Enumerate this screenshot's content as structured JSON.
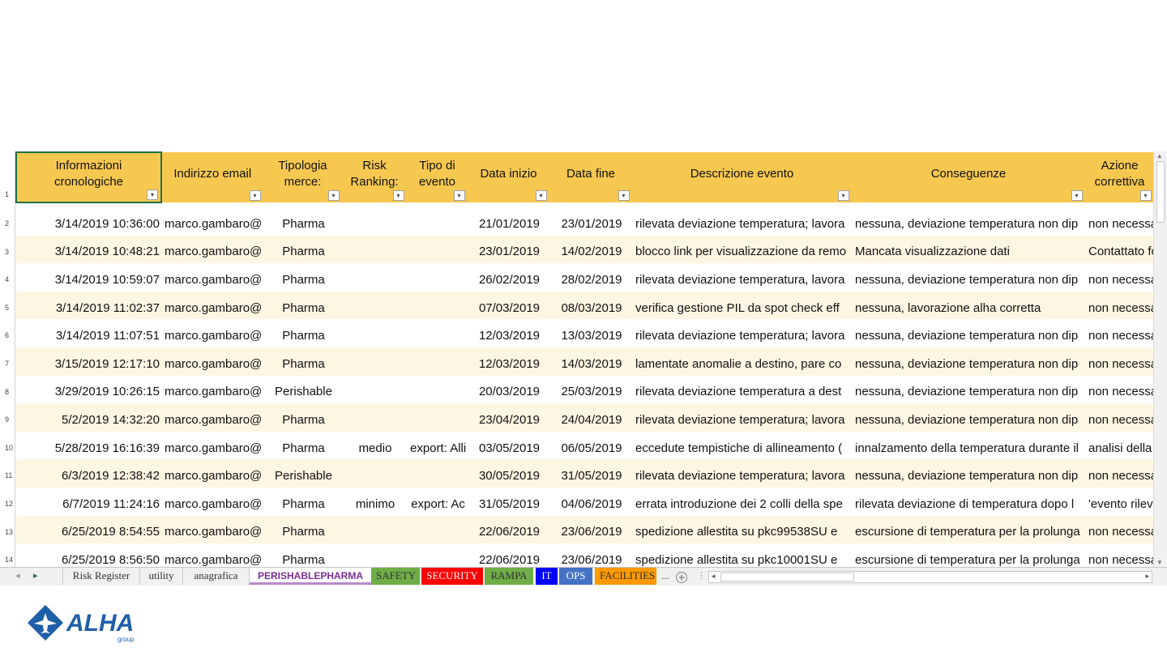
{
  "headers": [
    "Informazioni cronologiche",
    "Indirizzo email",
    "Tipologia merce:",
    "Risk Ranking:",
    "Tipo di evento",
    "Data inizio",
    "Data fine",
    "Descrizione evento",
    "Conseguenze",
    "Azione correttiva"
  ],
  "header_row_number": "1",
  "rows": [
    {
      "n": "2",
      "ts": "3/14/2019 10:36:00",
      "email": "marco.gambaro@",
      "merce": "Pharma",
      "risk": "",
      "tipo": "",
      "inizio": "21/01/2019",
      "fine": "23/01/2019",
      "desc": "rilevata deviazione temperatura; lavora",
      "cons": "nessuna, deviazione temperatura non dip",
      "azione": "non necessa"
    },
    {
      "n": "3",
      "ts": "3/14/2019 10:48:21",
      "email": "marco.gambaro@",
      "merce": "Pharma",
      "risk": "",
      "tipo": "",
      "inizio": "23/01/2019",
      "fine": "14/02/2019",
      "desc": "blocco link per visualizzazione da remo",
      "cons": "Mancata visualizzazione dati",
      "azione": "Contattato fo"
    },
    {
      "n": "4",
      "ts": "3/14/2019 10:59:07",
      "email": "marco.gambaro@",
      "merce": "Pharma",
      "risk": "",
      "tipo": "",
      "inizio": "26/02/2019",
      "fine": "28/02/2019",
      "desc": "rilevata deviazione temperatura, lavora",
      "cons": "nessuna, deviazione temperatura non dip",
      "azione": "non necessa"
    },
    {
      "n": "5",
      "ts": "3/14/2019 11:02:37",
      "email": "marco.gambaro@",
      "merce": "Pharma",
      "risk": "",
      "tipo": "",
      "inizio": "07/03/2019",
      "fine": "08/03/2019",
      "desc": "verifica gestione PIL da spot check eff",
      "cons": "nessuna, lavorazione alha corretta",
      "azione": "non necessa"
    },
    {
      "n": "6",
      "ts": "3/14/2019 11:07:51",
      "email": "marco.gambaro@",
      "merce": "Pharma",
      "risk": "",
      "tipo": "",
      "inizio": "12/03/2019",
      "fine": "13/03/2019",
      "desc": "rilevata deviazione temperatura; lavora",
      "cons": "nessuna, deviazione temperatura non dip",
      "azione": "non necessa"
    },
    {
      "n": "7",
      "ts": "3/15/2019 12:17:10",
      "email": "marco.gambaro@",
      "merce": "Pharma",
      "risk": "",
      "tipo": "",
      "inizio": "12/03/2019",
      "fine": "14/03/2019",
      "desc": "lamentate anomalie a destino, pare co",
      "cons": "nessuna, deviazione temperatura non dip",
      "azione": "non necessa"
    },
    {
      "n": "8",
      "ts": "3/29/2019 10:26:15",
      "email": "marco.gambaro@",
      "merce": "Perishable",
      "risk": "",
      "tipo": "",
      "inizio": "20/03/2019",
      "fine": "25/03/2019",
      "desc": "rilevata deviazione temperatura a dest",
      "cons": "nessuna, deviazione temperatura non dip",
      "azione": "non necessa"
    },
    {
      "n": "9",
      "ts": "5/2/2019 14:32:20",
      "email": "marco.gambaro@",
      "merce": "Pharma",
      "risk": "",
      "tipo": "",
      "inizio": "23/04/2019",
      "fine": "24/04/2019",
      "desc": "rilevata deviazione temperatura; lavora",
      "cons": "nessuna, deviazione temperatura non dip",
      "azione": "non necessa"
    },
    {
      "n": "10",
      "ts": "5/28/2019 16:16:39",
      "email": "marco.gambaro@",
      "merce": "Pharma",
      "risk": "medio",
      "tipo": "export: Alli",
      "inizio": "03/05/2019",
      "fine": "06/05/2019",
      "desc": "eccedute tempistiche di allineamento (",
      "cons": "innalzamento della temperatura durante il",
      "azione": "analisi della"
    },
    {
      "n": "11",
      "ts": "6/3/2019 12:38:42",
      "email": "marco.gambaro@",
      "merce": "Perishable",
      "risk": "",
      "tipo": "",
      "inizio": "30/05/2019",
      "fine": "31/05/2019",
      "desc": "rilevata deviazione temperatura; lavora",
      "cons": "nessuna, deviazione temperatura non dip",
      "azione": "non necessa"
    },
    {
      "n": "12",
      "ts": "6/7/2019 11:24:16",
      "email": "marco.gambaro@",
      "merce": "Pharma",
      "risk": "minimo",
      "tipo": "export: Ac",
      "inizio": "31/05/2019",
      "fine": "04/06/2019",
      "desc": "errata introduzione dei 2 colli della spe",
      "cons": "rilevata deviazione di temperatura dopo l",
      "azione": "'evento rileva"
    },
    {
      "n": "13",
      "ts": "6/25/2019 8:54:55",
      "email": "marco.gambaro@",
      "merce": "Pharma",
      "risk": "",
      "tipo": "",
      "inizio": "22/06/2019",
      "fine": "23/06/2019",
      "desc": "spedizione allestita su pkc99538SU e",
      "cons": "escursione di temperatura per la prolunga",
      "azione": "non necessa"
    },
    {
      "n": "14",
      "ts": "6/25/2019 8:56:50",
      "email": "marco.gambaro@",
      "merce": "Pharma",
      "risk": "",
      "tipo": "",
      "inizio": "22/06/2019",
      "fine": "23/06/2019",
      "desc": "spedizione allestita su pkc10001SU e",
      "cons": "escursione di temperatura per la prolunga",
      "azione": "non necessa"
    }
  ],
  "tabs": {
    "risk_register": "Risk Register",
    "utility": "utility",
    "anagrafica": "anagrafica",
    "perishablepharma": "PERISHABLEPHARMA",
    "safety": "SAFETY",
    "security": "SECURITY",
    "rampa": "RAMPA",
    "it": "IT",
    "ops": "OPS",
    "facilities": "FACILITIES",
    "more": "..."
  },
  "tab_colors": {
    "safety": "#70ad47",
    "security": "#ff0000",
    "rampa": "#70ad47",
    "it": "#0000ff",
    "ops": "#4472c4",
    "facilities": "#ff9900"
  },
  "header_color": "#f7c850",
  "logo": {
    "brand": "ALHA",
    "sub": "group",
    "color": "#1f5fa8"
  }
}
